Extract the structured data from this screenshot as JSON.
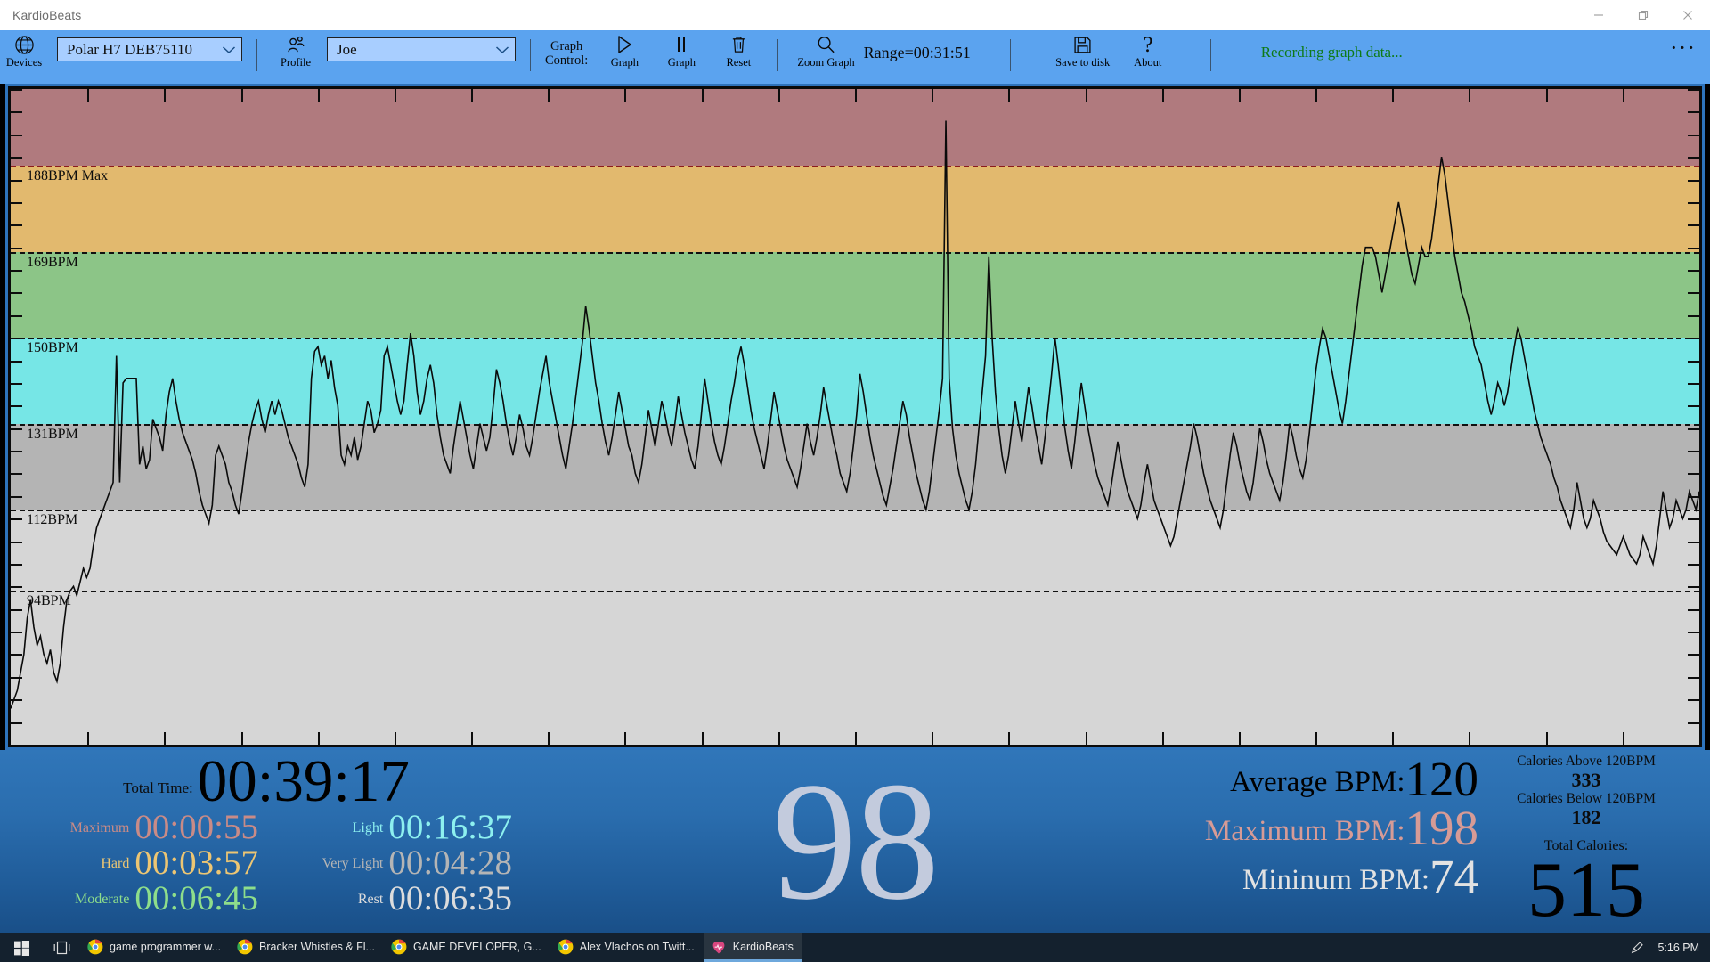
{
  "window": {
    "title": "KardioBeats",
    "controls": {
      "minimize": "minimize-icon",
      "maximize": "maximize-icon",
      "close": "close-icon"
    }
  },
  "toolbar": {
    "devices_caption": "Devices",
    "devices_icon": "globe-icon",
    "device_value": "Polar H7 DEB75110",
    "profile_caption": "Profile",
    "profile_icon": "person-icon",
    "profile_value": "Joe",
    "graph_control_label": "Graph\nControl:",
    "graph_control_line1": "Graph",
    "graph_control_line2": "Control:",
    "play_caption": "Graph",
    "play_icon": "play-icon",
    "pause_caption": "Graph",
    "pause_icon": "pause-icon",
    "reset_caption": "Reset",
    "reset_icon": "trash-icon",
    "zoom_caption": "Zoom Graph",
    "zoom_icon": "magnifier-icon",
    "range_label": "Range=00:31:51",
    "save_caption": "Save to disk",
    "save_icon": "floppy-disk-icon",
    "about_caption": "About",
    "about_icon": "question-mark-icon",
    "status_text": "Recording graph data...",
    "status_color": "#0e7a16",
    "overflow": "···"
  },
  "chart_data": {
    "type": "line",
    "title": "",
    "xlabel": "",
    "ylabel": "BPM",
    "ylim": [
      60,
      205
    ],
    "grid": false,
    "legend": "none",
    "zones": [
      {
        "name": "Maximum",
        "label": "188BPM Max",
        "from": 188,
        "to": 205,
        "color": "#b07a7e",
        "line_color": "#8b1b1b"
      },
      {
        "name": "Hard",
        "label": "169BPM",
        "from": 169,
        "to": 188,
        "color": "#e2b96e",
        "line_color": "#101010"
      },
      {
        "name": "Moderate",
        "label": "150BPM",
        "from": 150,
        "to": 169,
        "color": "#8cc587",
        "line_color": "#101010"
      },
      {
        "name": "Light",
        "label": "131BPM",
        "from": 131,
        "to": 150,
        "color": "#76e6e6",
        "line_color": "#101010"
      },
      {
        "name": "Very Light",
        "label": "112BPM",
        "from": 112,
        "to": 131,
        "color": "#b4b4b4",
        "line_color": "#101010"
      },
      {
        "name": "Rest",
        "label": "94BPM",
        "from": 94,
        "to": 112,
        "color": "#d6d6d6",
        "line_color": "#101010"
      }
    ],
    "zone_thresholds": [
      188,
      169,
      150,
      131,
      112,
      94
    ],
    "series": [
      {
        "name": "Heart Rate",
        "color": "#0a0a0a",
        "values": [
          68,
          70,
          72,
          76,
          80,
          88,
          92,
          86,
          82,
          84,
          80,
          78,
          81,
          76,
          74,
          78,
          86,
          92,
          94,
          95,
          93,
          96,
          99,
          97,
          99,
          104,
          108,
          110,
          112,
          114,
          116,
          118,
          146,
          118,
          140,
          141,
          141,
          141,
          141,
          122,
          126,
          121,
          123,
          132,
          130,
          128,
          125,
          133,
          138,
          141,
          136,
          132,
          129,
          127,
          125,
          123,
          120,
          116,
          113,
          111,
          109,
          113,
          124,
          126,
          124,
          122,
          118,
          116,
          113,
          111,
          116,
          122,
          127,
          131,
          134,
          136,
          132,
          129,
          133,
          136,
          133,
          136,
          134,
          131,
          128,
          126,
          124,
          122,
          119,
          117,
          122,
          141,
          147,
          148,
          144,
          146,
          141,
          145,
          139,
          135,
          124,
          122,
          126,
          124,
          128,
          123,
          126,
          131,
          136,
          134,
          129,
          131,
          134,
          146,
          148,
          144,
          140,
          136,
          133,
          136,
          144,
          151,
          146,
          138,
          133,
          136,
          141,
          144,
          140,
          133,
          128,
          124,
          122,
          120,
          126,
          131,
          136,
          132,
          128,
          124,
          121,
          126,
          131,
          128,
          125,
          128,
          135,
          143,
          140,
          136,
          131,
          127,
          124,
          128,
          133,
          130,
          126,
          124,
          128,
          133,
          138,
          142,
          146,
          140,
          136,
          132,
          128,
          124,
          121,
          126,
          131,
          137,
          143,
          149,
          157,
          152,
          146,
          140,
          136,
          131,
          127,
          124,
          128,
          133,
          138,
          134,
          130,
          126,
          124,
          120,
          118,
          122,
          128,
          134,
          130,
          126,
          131,
          136,
          133,
          129,
          126,
          131,
          137,
          133,
          129,
          126,
          123,
          121,
          126,
          133,
          141,
          136,
          131,
          127,
          124,
          122,
          126,
          131,
          136,
          140,
          145,
          148,
          144,
          139,
          134,
          130,
          127,
          124,
          121,
          126,
          132,
          138,
          134,
          130,
          126,
          123,
          121,
          119,
          117,
          121,
          126,
          131,
          127,
          124,
          128,
          133,
          139,
          135,
          131,
          127,
          124,
          120,
          118,
          116,
          120,
          126,
          133,
          142,
          138,
          133,
          128,
          124,
          121,
          118,
          115,
          113,
          117,
          121,
          126,
          131,
          136,
          133,
          128,
          124,
          120,
          117,
          114,
          112,
          116,
          122,
          128,
          134,
          141,
          198,
          141,
          130,
          124,
          120,
          117,
          114,
          112,
          116,
          122,
          130,
          138,
          146,
          168,
          150,
          138,
          130,
          124,
          120,
          124,
          130,
          136,
          131,
          127,
          133,
          139,
          135,
          130,
          126,
          122,
          128,
          135,
          142,
          150,
          144,
          137,
          130,
          125,
          121,
          127,
          134,
          140,
          135,
          130,
          126,
          122,
          119,
          117,
          115,
          113,
          117,
          122,
          127,
          123,
          119,
          116,
          114,
          112,
          110,
          113,
          118,
          122,
          118,
          114,
          112,
          110,
          108,
          106,
          104,
          106,
          110,
          114,
          118,
          122,
          126,
          131,
          128,
          124,
          120,
          117,
          114,
          112,
          110,
          108,
          112,
          118,
          124,
          129,
          126,
          122,
          119,
          116,
          114,
          118,
          124,
          130,
          127,
          123,
          120,
          118,
          116,
          114,
          118,
          124,
          131,
          128,
          124,
          121,
          119,
          123,
          129,
          136,
          143,
          148,
          152,
          150,
          146,
          142,
          138,
          134,
          131,
          136,
          142,
          148,
          154,
          160,
          166,
          170,
          170,
          170,
          168,
          164,
          160,
          164,
          168,
          172,
          176,
          180,
          176,
          172,
          168,
          164,
          162,
          166,
          170,
          168,
          168,
          172,
          178,
          184,
          190,
          186,
          180,
          174,
          168,
          164,
          160,
          158,
          155,
          152,
          148,
          146,
          144,
          140,
          136,
          133,
          136,
          140,
          138,
          135,
          138,
          143,
          148,
          152,
          150,
          146,
          142,
          138,
          134,
          131,
          128,
          126,
          124,
          122,
          119,
          117,
          114,
          112,
          110,
          108,
          112,
          118,
          114,
          110,
          108,
          110,
          114,
          112,
          110,
          107,
          105,
          104,
          103,
          102,
          104,
          106,
          104,
          102,
          101,
          100,
          102,
          106,
          104,
          102,
          100,
          104,
          110,
          116,
          112,
          108,
          110,
          114,
          112,
          110,
          112,
          116,
          114,
          112,
          116
        ]
      }
    ]
  },
  "stats": {
    "total_time_label": "Total Time:",
    "total_time_value": "00:39:17",
    "zone_times": [
      {
        "label": "Maximum",
        "value": "00:00:55",
        "color": "#c98b87"
      },
      {
        "label": "Hard",
        "value": "00:03:57",
        "color": "#edc673"
      },
      {
        "label": "Moderate",
        "value": "00:06:45",
        "color": "#8ede8b"
      },
      {
        "label": "Light",
        "value": "00:16:37",
        "color": "#8df0ef"
      },
      {
        "label": "Very Light",
        "value": "00:04:28",
        "color": "#b5b5b5"
      },
      {
        "label": "Rest",
        "value": "00:06:35",
        "color": "#dcdcdc"
      }
    ],
    "current_bpm": "98",
    "average_bpm_label": "Average BPM:",
    "average_bpm_value": "120",
    "average_bpm_color": "#000000",
    "maximum_bpm_label": "Maximum BPM:",
    "maximum_bpm_value": "198",
    "maximum_bpm_color": "#d79b96",
    "minimum_bpm_label": "Mininum BPM:",
    "minimum_bpm_value": "74",
    "minimum_bpm_color": "#e2e2e2",
    "calories_above_label": "Calories Above 120BPM",
    "calories_above_value": "333",
    "calories_below_label": "Calories Below 120BPM",
    "calories_below_value": "182",
    "total_calories_label": "Total Calories:",
    "total_calories_value": "515"
  },
  "taskbar": {
    "start_icon": "windows-start-icon",
    "taskview_icon": "task-view-icon",
    "items": [
      {
        "label": "game programmer w...",
        "icon": "chrome-icon",
        "active": false
      },
      {
        "label": "Bracker Whistles & Fl...",
        "icon": "chrome-icon",
        "active": false
      },
      {
        "label": "GAME DEVELOPER, G...",
        "icon": "chrome-icon",
        "active": false
      },
      {
        "label": "Alex Vlachos on Twitt...",
        "icon": "chrome-icon",
        "active": false
      },
      {
        "label": "KardioBeats",
        "icon": "kardiobeats-icon",
        "active": true
      }
    ],
    "tray_icon": "pen-icon",
    "clock": "5:16 PM"
  }
}
